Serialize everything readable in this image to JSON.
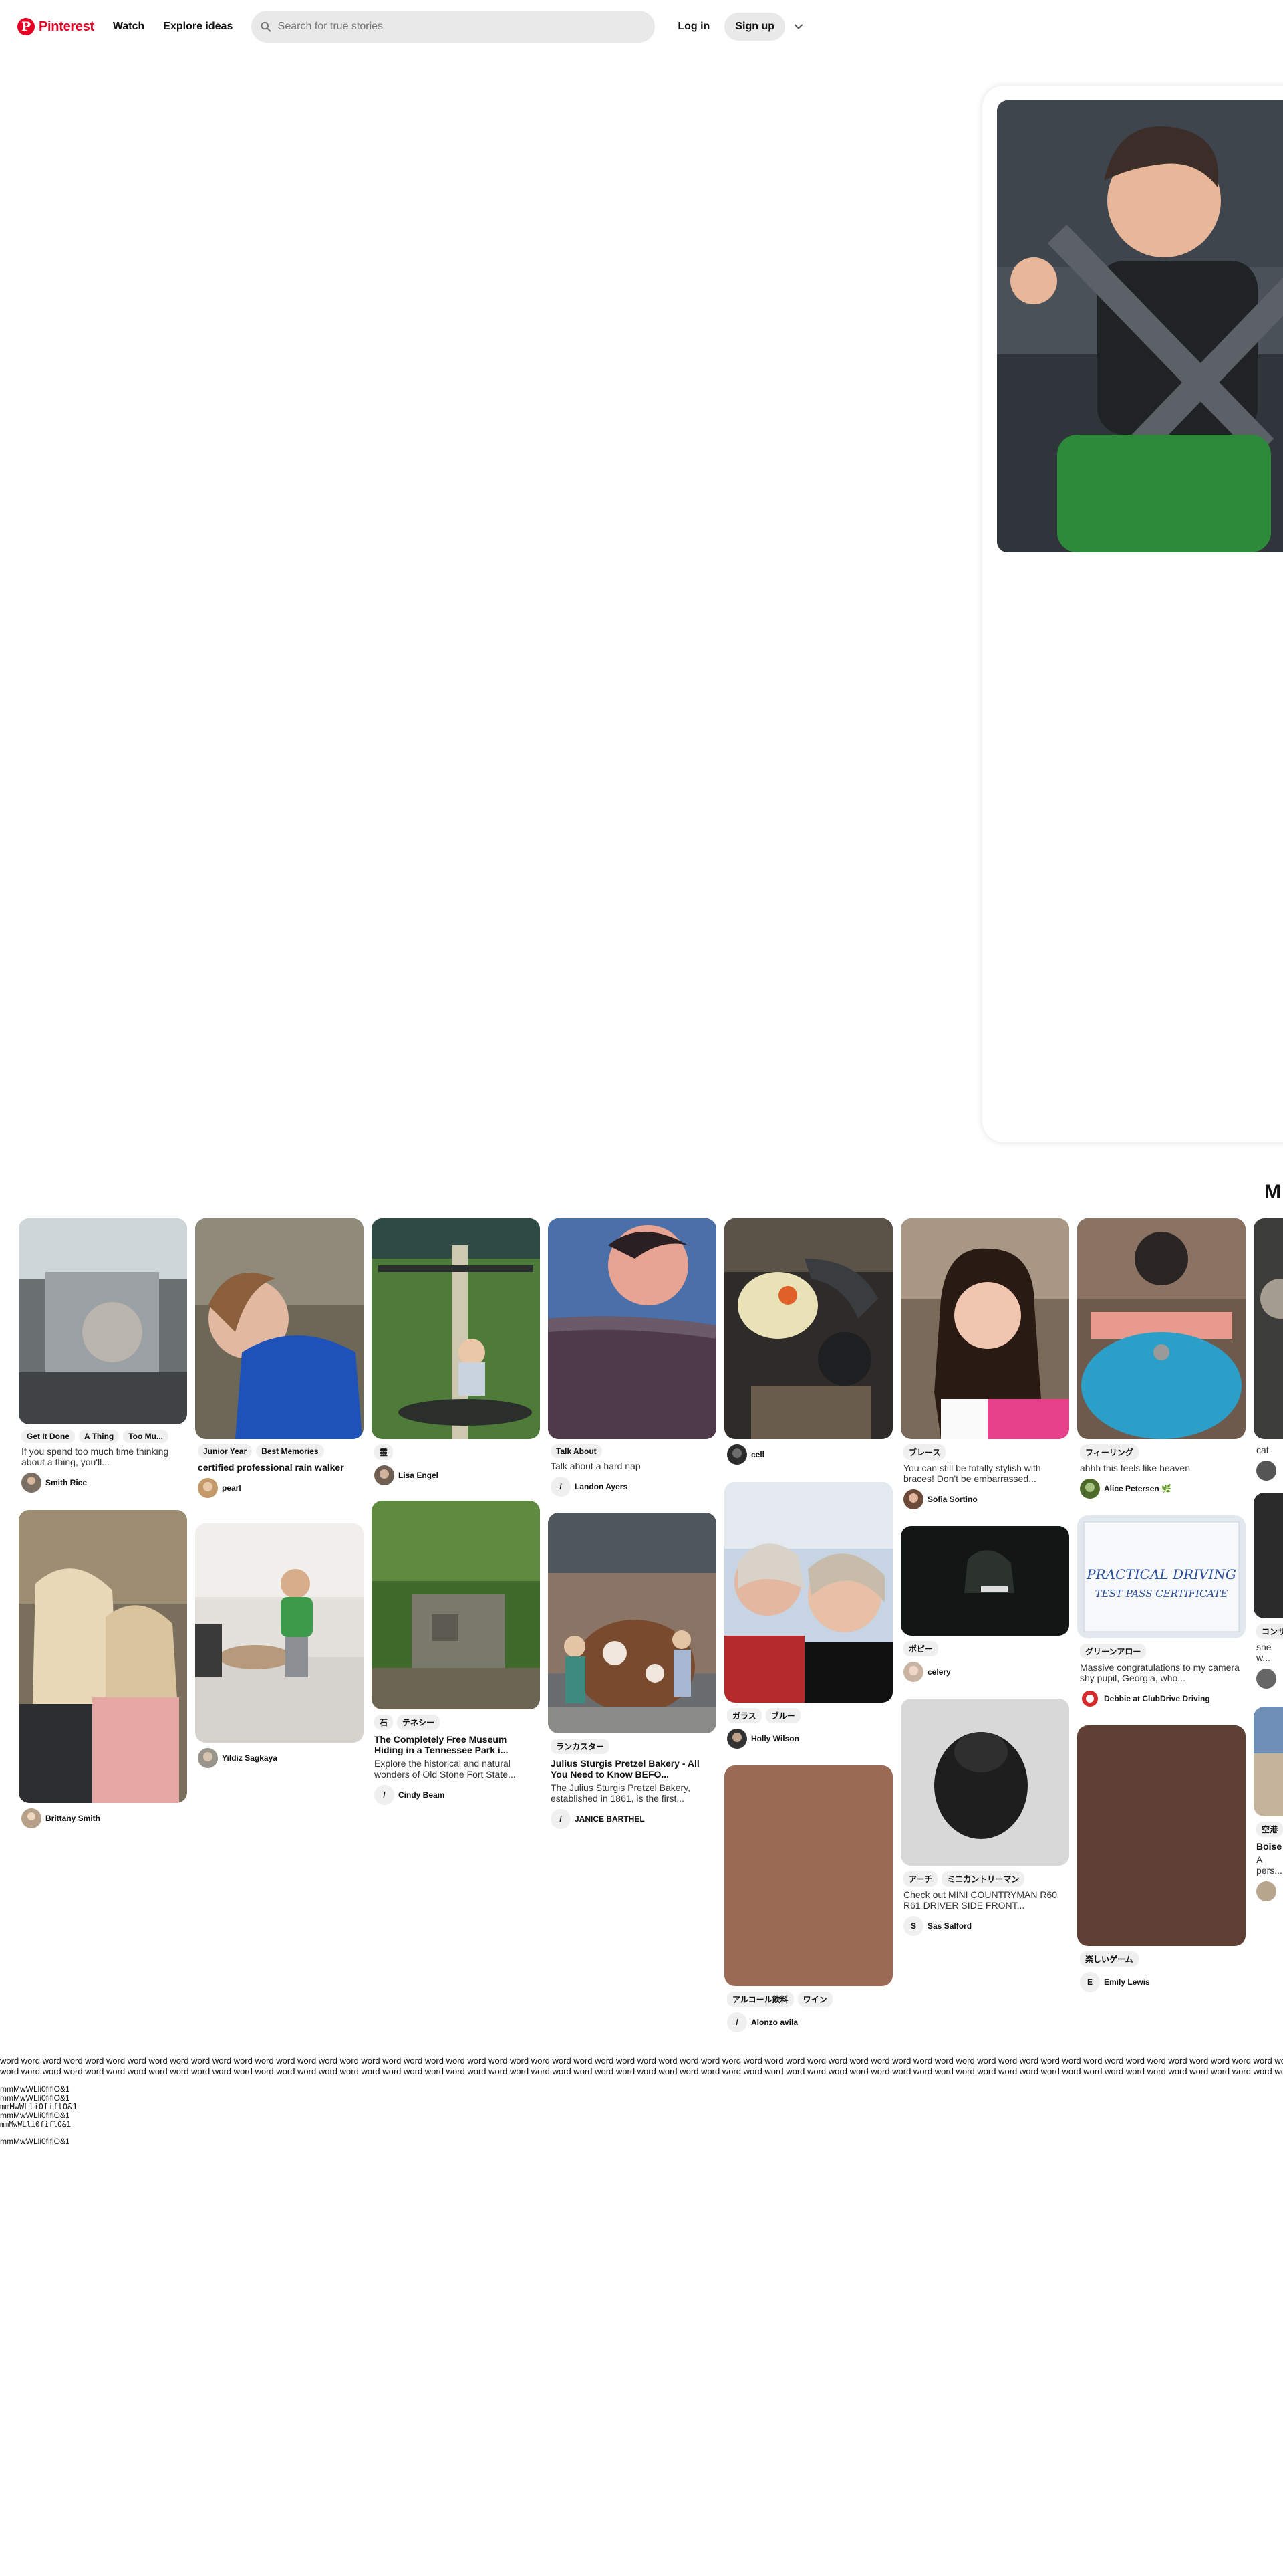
{
  "header": {
    "logo_text": "Pinterest",
    "nav": [
      "Watch",
      "Explore ideas"
    ],
    "search_placeholder": "Search for true stories",
    "login_label": "Log in",
    "signup_label": "Sign up"
  },
  "closeup": {
    "heading_partial": "M"
  },
  "pins": [
    {
      "tags": [
        "Get It Done",
        "A Thing",
        "Too Mu..."
      ],
      "title": "",
      "desc": "If you spend too much time thinking about a thing, you'll...",
      "user": "Smith Rice"
    },
    {
      "tags": [],
      "title": "",
      "desc": "",
      "user": "Brittany Smith"
    },
    {
      "tags": [
        "Junior Year",
        "Best Memories"
      ],
      "title": "certified professional rain walker",
      "desc": "",
      "user": "pearl"
    },
    {
      "tags": [],
      "title": "",
      "desc": "",
      "user": "Yildiz Sagkaya"
    },
    {
      "tags": [
        "靈"
      ],
      "title": "",
      "desc": "",
      "user": "Lisa Engel"
    },
    {
      "tags": [
        "石",
        "テネシー"
      ],
      "title": "The Completely Free Museum Hiding in a Tennessee Park i...",
      "desc": "Explore the historical and natural wonders of Old Stone Fort State...",
      "user": "Cindy Beam",
      "user_initial": "/"
    },
    {
      "tags": [
        "Talk About"
      ],
      "title": "",
      "desc": "Talk about a hard nap",
      "user": "Landon Ayers",
      "user_initial": "/"
    },
    {
      "tags": [
        "ランカスター"
      ],
      "title": "Julius Sturgis Pretzel Bakery - All You Need to Know BEFO...",
      "desc": "The Julius Sturgis Pretzel Bakery, established in 1861, is the first...",
      "user": "JANICE BARTHEL",
      "user_initial": "/"
    },
    {
      "tags": [],
      "title": "",
      "desc": "",
      "user": "cell"
    },
    {
      "tags": [
        "ガラス",
        "ブルー"
      ],
      "title": "",
      "desc": "",
      "user": "Holly Wilson"
    },
    {
      "tags": [
        "アルコール飲料",
        "ワイン"
      ],
      "title": "",
      "desc": "",
      "user": "Alonzo avila",
      "user_initial": "/"
    },
    {
      "tags": [
        "ブレース"
      ],
      "title": "",
      "desc": "You can still be totally stylish with braces! Don't be embarrassed...",
      "user": "Sofia Sortino"
    },
    {
      "tags": [
        "ポピー"
      ],
      "title": "",
      "desc": "",
      "user": "celery"
    },
    {
      "tags": [
        "アーチ",
        "ミニカントリーマン"
      ],
      "title": "",
      "desc": "Check out MINI COUNTRYMAN R60 R61 DRIVER SIDE FRONT...",
      "user": "Sas Salford",
      "user_initial": "S"
    },
    {
      "tags": [
        "フィーリング"
      ],
      "title": "",
      "desc": "ahhh this feels like heaven",
      "user": "Alice Petersen 🌿"
    },
    {
      "tags": [
        "グリーンアロー"
      ],
      "title": "",
      "desc": "Massive congratulations to my camera shy pupil, Georgia, who...",
      "user": "Debbie at ClubDrive Driving"
    },
    {
      "tags": [
        "楽しいゲーム"
      ],
      "title": "",
      "desc": "",
      "user": "Emily Lewis",
      "user_initial": "E"
    },
    {
      "tags": [],
      "title": "",
      "desc": "cat",
      "user": "T"
    },
    {
      "tags": [
        "コンサ"
      ],
      "title": "",
      "desc": "she w... aroun...",
      "user": ""
    },
    {
      "tags": [
        "空港"
      ],
      "title": "Boise",
      "desc": "A pers... sauce...",
      "user": ""
    }
  ],
  "footer": {
    "word_line": "word word word word word word word word word word word word word word word word word word word word word word word word word word word word word word word word word word word word word word word word word word word word word word word word word word word word word word word word word word word word word word word word word word word word word word word word word word word word word word word word word word word word word word word word word word word word word word word word word word word word word word word word word word word word word word word word word word word word word word word word word word word word word word word word word",
    "m_lines": [
      "mmMwWLli0fiflO&1",
      "mmMwWLli0fiflO&1",
      "mmMwWLli0fiflO&1",
      "mmMwWLli0fiflO&1",
      "mmMwWLli0fiflO&1",
      "",
      "mmMwWLli0fiflO&1"
    ]
  },
  "colors": {
    "brand": "#e60023",
    "chip": "#efefef",
    "search_bg": "#e9e9e9"
  }
}
